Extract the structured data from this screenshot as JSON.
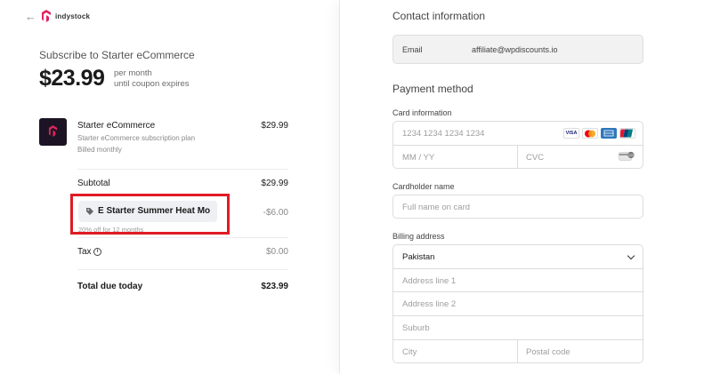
{
  "brand": {
    "name": "indystock",
    "accent": "#e0245e"
  },
  "summary": {
    "subscribe_title": "Subscribe to Starter eCommerce",
    "price": "$23.99",
    "per_line1": "per month",
    "per_line2": "until coupon expires"
  },
  "product": {
    "name": "Starter eCommerce",
    "description": "Starter eCommerce subscription plan",
    "billing": "Billed monthly",
    "price": "$29.99"
  },
  "subtotal": {
    "label": "Subtotal",
    "value": "$29.99"
  },
  "coupon": {
    "code": "E Starter Summer Heat Mo",
    "subtext": "20% off for 12 months",
    "discount": "-$6.00",
    "highlight_color": "#e01b24"
  },
  "tax": {
    "label": "Tax",
    "value": "$0.00"
  },
  "total": {
    "label": "Total due today",
    "value": "$23.99"
  },
  "contact": {
    "title": "Contact information",
    "email_label": "Email",
    "email_value": "affiliate@wpdiscounts.io"
  },
  "payment": {
    "title": "Payment method",
    "card_info_label": "Card information",
    "card_number_placeholder": "1234 1234 1234 1234",
    "expiry_placeholder": "MM / YY",
    "cvc_placeholder": "CVC",
    "card_brands": [
      "VISA",
      "mastercard",
      "AMEX",
      "UnionPay"
    ],
    "cardholder_label": "Cardholder name",
    "cardholder_placeholder": "Full name on card",
    "billing_label": "Billing address",
    "country": "Pakistan",
    "address1_placeholder": "Address line 1",
    "address2_placeholder": "Address line 2",
    "suburb_placeholder": "Suburb",
    "city_placeholder": "City",
    "postal_placeholder": "Postal code"
  }
}
